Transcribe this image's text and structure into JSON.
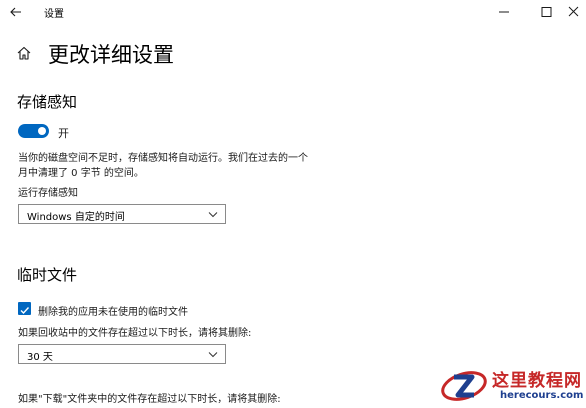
{
  "app": {
    "title": "设置"
  },
  "header": {
    "title": "更改详细设置"
  },
  "storage_sense": {
    "heading": "存储感知",
    "toggle_state": "开",
    "description_line1": "当你的磁盘空间不足时，存储感知将自动运行。我们在过去的一个",
    "description_line2": "月中清理了 0 字节 的空间。",
    "run_label": "运行存储感知",
    "run_value": "Windows 自定的时间"
  },
  "temp_files": {
    "heading": "临时文件",
    "checkbox_label": "删除我的应用未在使用的临时文件",
    "checkbox_checked": true,
    "recycle_label": "如果回收站中的文件存在超过以下时长，请将其删除:",
    "recycle_value": "30 天",
    "downloads_label": "如果\"下载\"文件夹中的文件存在超过以下时长，请将其删除:"
  },
  "watermark": {
    "name": "这里教程网",
    "url": "herecours.com"
  },
  "colors": {
    "accent": "#0067c0",
    "watermark_red": "#c62828",
    "watermark_blue": "#1e3f8f"
  }
}
